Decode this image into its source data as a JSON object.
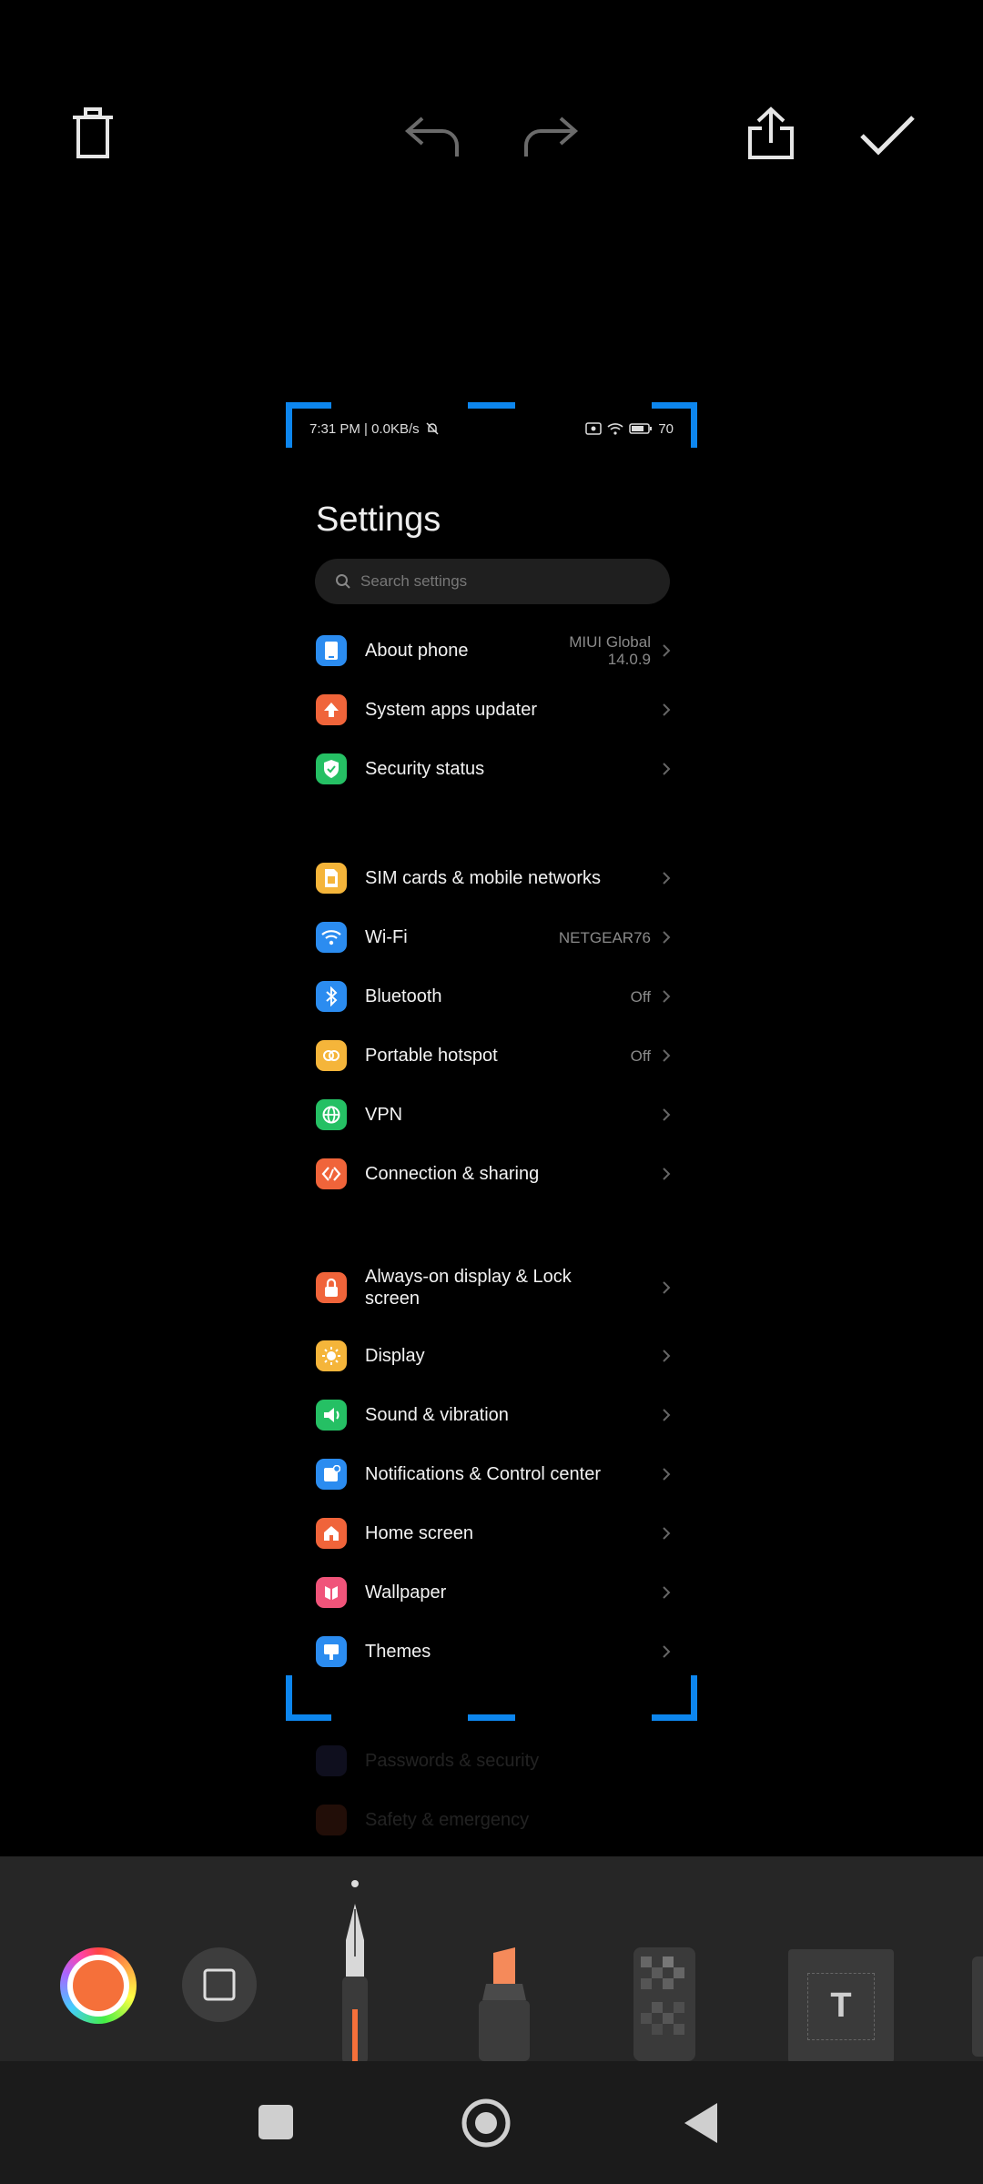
{
  "toolbar": {
    "delete_icon": "trash-icon",
    "undo_icon": "undo-icon",
    "redo_icon": "redo-icon",
    "share_icon": "share-icon",
    "confirm_icon": "checkmark-icon"
  },
  "preview": {
    "status_bar": {
      "left": "7:31 PM | 0.0KB/s",
      "battery": "70"
    },
    "title": "Settings",
    "search_placeholder": "Search settings",
    "items": [
      {
        "label": "About phone",
        "value": "MIUI Global 14.0.9",
        "value_line1": "MIUI Global",
        "value_line2": "14.0.9",
        "icon": "phone-icon",
        "color": "#2b8cf0"
      },
      {
        "label": "System apps updater",
        "value": "",
        "icon": "arrow-up-icon",
        "color": "#f0643a"
      },
      {
        "label": "Security status",
        "value": "",
        "icon": "shield-check-icon",
        "color": "#25c064"
      },
      {
        "label": "SIM cards & mobile networks",
        "value": "",
        "icon": "sim-icon",
        "color": "#f5b53a"
      },
      {
        "label": "Wi-Fi",
        "value": "NETGEAR76",
        "icon": "wifi-icon",
        "color": "#2b8cf0"
      },
      {
        "label": "Bluetooth",
        "value": "Off",
        "icon": "bluetooth-icon",
        "color": "#2b8cf0"
      },
      {
        "label": "Portable hotspot",
        "value": "Off",
        "icon": "hotspot-icon",
        "color": "#f5b53a"
      },
      {
        "label": "VPN",
        "value": "",
        "icon": "globe-icon",
        "color": "#25c064"
      },
      {
        "label": "Connection & sharing",
        "value": "",
        "icon": "connection-icon",
        "color": "#f0643a"
      },
      {
        "label": "Always-on display & Lock screen",
        "label_line1": "Always-on display & Lock",
        "label_line2": "screen",
        "value": "",
        "icon": "lock-icon",
        "color": "#f0643a"
      },
      {
        "label": "Display",
        "value": "",
        "icon": "sun-icon",
        "color": "#f5b53a"
      },
      {
        "label": "Sound & vibration",
        "value": "",
        "icon": "speaker-icon",
        "color": "#25c064"
      },
      {
        "label": "Notifications & Control center",
        "value": "",
        "icon": "notification-icon",
        "color": "#2b8cf0"
      },
      {
        "label": "Home screen",
        "value": "",
        "icon": "home-icon",
        "color": "#f0643a"
      },
      {
        "label": "Wallpaper",
        "value": "",
        "icon": "wallpaper-icon",
        "color": "#f0547a"
      },
      {
        "label": "Themes",
        "value": "",
        "icon": "themes-icon",
        "color": "#2b8cf0"
      },
      {
        "label": "Passwords & security",
        "value": "",
        "icon": "key-icon",
        "color": "#6b6bd8"
      },
      {
        "label": "Safety & emergency",
        "value": "",
        "icon": "emergency-icon",
        "color": "#f0643a"
      }
    ]
  },
  "drawing_tools": {
    "color_picker_icon": "color-wheel-icon",
    "shape_tool_icon": "square-shape-icon",
    "tools": [
      "pen",
      "highlighter",
      "mosaic",
      "text"
    ],
    "selected_tool": "pen",
    "text_tool_letter": "T",
    "accent_color": "#f5703a"
  },
  "navigation": {
    "recents_icon": "recents-square-icon",
    "home_icon": "home-circle-icon",
    "back_icon": "back-triangle-icon"
  }
}
